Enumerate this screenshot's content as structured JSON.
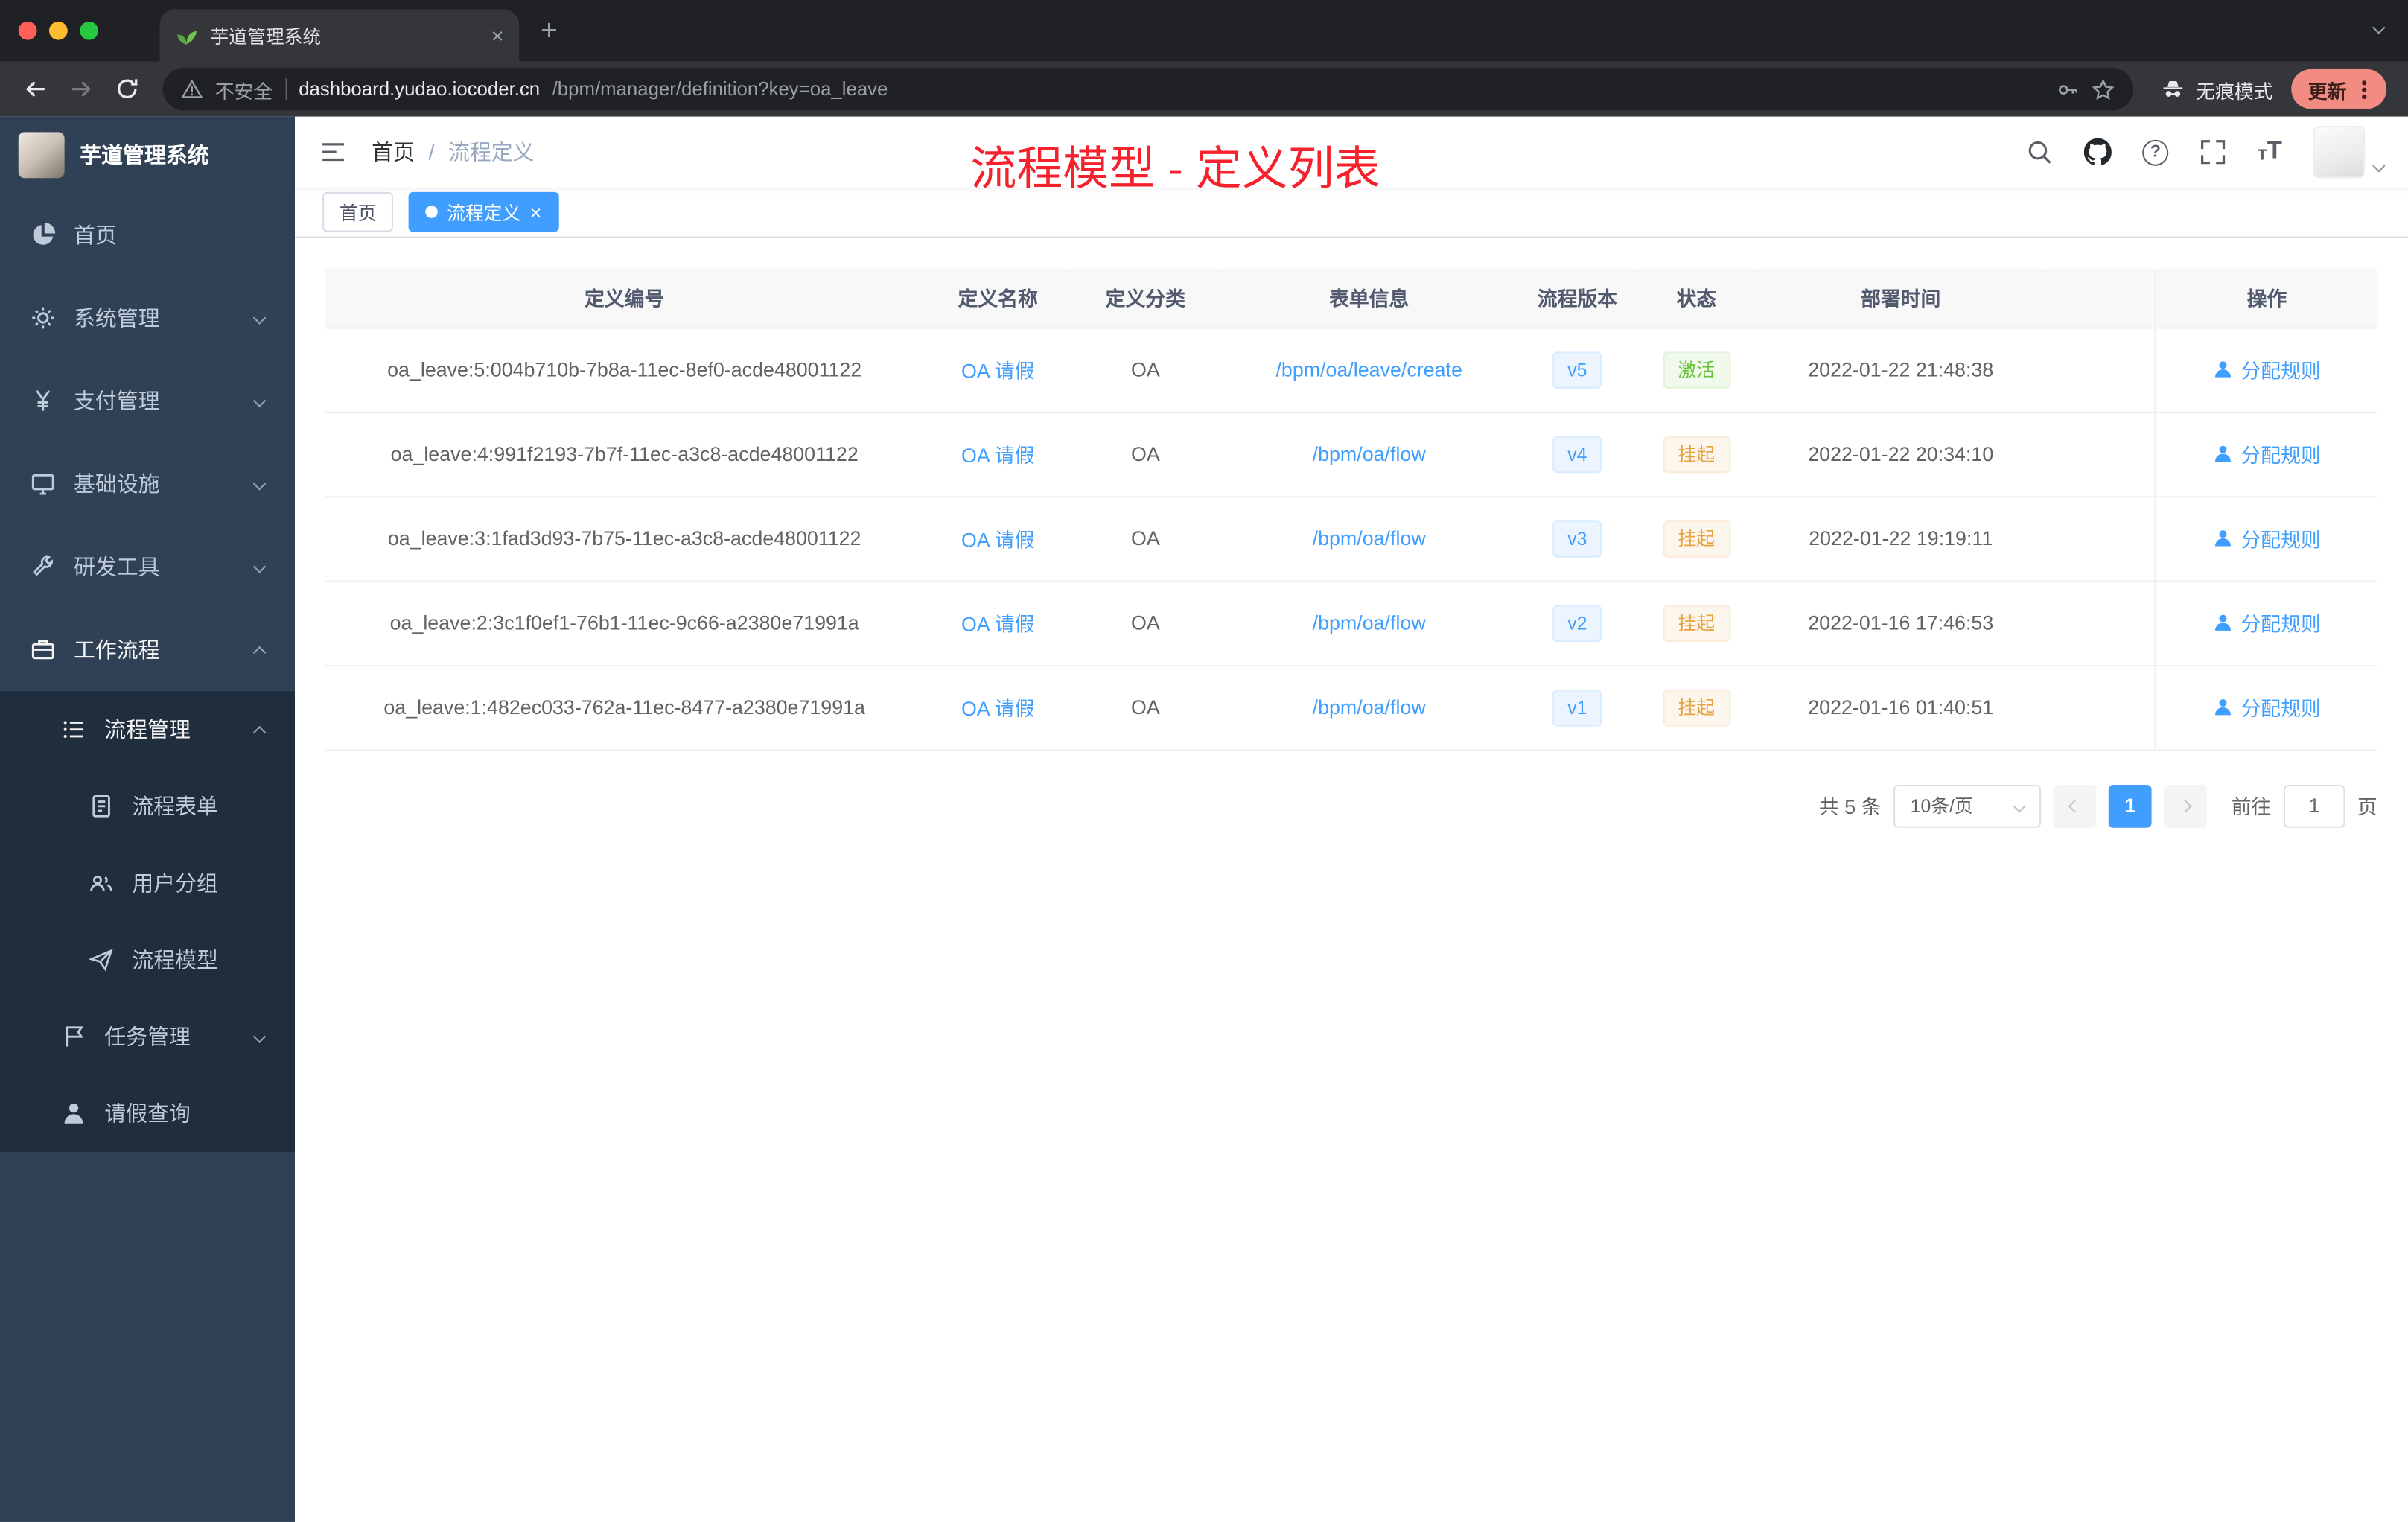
{
  "browser": {
    "tab_title": "芋道管理系统",
    "security_label": "不安全",
    "url_host": "dashboard.yudao.iocoder.cn",
    "url_path": "/bpm/manager/definition?key=oa_leave",
    "incognito_label": "无痕模式",
    "update_label": "更新",
    "icons": [
      "back-icon",
      "forward-icon",
      "reload-icon",
      "warning-icon",
      "key-icon",
      "star-icon",
      "incognito-icon",
      "kebab-menu-icon",
      "new-tab-icon",
      "tab-close-icon",
      "tab-search-icon",
      "site-favicon"
    ]
  },
  "sidebar": {
    "logo_title": "芋道管理系统",
    "items": [
      {
        "label": "首页",
        "icon": "dashboard-icon",
        "level": 1
      },
      {
        "label": "系统管理",
        "icon": "gear-icon",
        "level": 1,
        "state": "collapsed"
      },
      {
        "label": "支付管理",
        "icon": "yen-icon",
        "level": 1,
        "state": "collapsed"
      },
      {
        "label": "基础设施",
        "icon": "monitor-icon",
        "level": 1,
        "state": "collapsed"
      },
      {
        "label": "研发工具",
        "icon": "tool-icon",
        "level": 1,
        "state": "collapsed"
      },
      {
        "label": "工作流程",
        "icon": "briefcase-icon",
        "level": 1,
        "state": "expanded"
      },
      {
        "label": "流程管理",
        "icon": "list-icon",
        "level": 2,
        "state": "expanded"
      },
      {
        "label": "流程表单",
        "icon": "form-icon",
        "level": 3
      },
      {
        "label": "用户分组",
        "icon": "user-group-icon",
        "level": 3
      },
      {
        "label": "流程模型",
        "icon": "paper-plane-icon",
        "level": 3
      },
      {
        "label": "任务管理",
        "icon": "task-icon",
        "level": 2,
        "state": "collapsed"
      },
      {
        "label": "请假查询",
        "icon": "person-icon",
        "level": 2
      }
    ]
  },
  "header": {
    "breadcrumb_home": "首页",
    "breadcrumb_current": "流程定义",
    "annotation": "流程模型 - 定义列表",
    "icons": [
      "hamburger-icon",
      "search-icon",
      "github-icon",
      "help-icon",
      "fullscreen-icon",
      "font-size-icon",
      "avatar",
      "chevron-down-icon"
    ]
  },
  "tags": [
    {
      "label": "首页",
      "active": false
    },
    {
      "label": "流程定义",
      "active": true
    }
  ],
  "table": {
    "columns": [
      "定义编号",
      "定义名称",
      "定义分类",
      "表单信息",
      "流程版本",
      "状态",
      "部署时间",
      "操作"
    ],
    "rows": [
      {
        "id": "oa_leave:5:004b710b-7b8a-11ec-8ef0-acde48001122",
        "name": "OA 请假",
        "category": "OA",
        "form": "/bpm/oa/leave/create",
        "version": "v5",
        "status": "激活",
        "status_type": "success",
        "deploy_time": "2022-01-22 21:48:38",
        "action": "分配规则"
      },
      {
        "id": "oa_leave:4:991f2193-7b7f-11ec-a3c8-acde48001122",
        "name": "OA 请假",
        "category": "OA",
        "form": "/bpm/oa/flow",
        "version": "v4",
        "status": "挂起",
        "status_type": "warning",
        "deploy_time": "2022-01-22 20:34:10",
        "action": "分配规则"
      },
      {
        "id": "oa_leave:3:1fad3d93-7b75-11ec-a3c8-acde48001122",
        "name": "OA 请假",
        "category": "OA",
        "form": "/bpm/oa/flow",
        "version": "v3",
        "status": "挂起",
        "status_type": "warning",
        "deploy_time": "2022-01-22 19:19:11",
        "action": "分配规则"
      },
      {
        "id": "oa_leave:2:3c1f0ef1-76b1-11ec-9c66-a2380e71991a",
        "name": "OA 请假",
        "category": "OA",
        "form": "/bpm/oa/flow",
        "version": "v2",
        "status": "挂起",
        "status_type": "warning",
        "deploy_time": "2022-01-16 17:46:53",
        "action": "分配规则"
      },
      {
        "id": "oa_leave:1:482ec033-762a-11ec-8477-a2380e71991a",
        "name": "OA 请假",
        "category": "OA",
        "form": "/bpm/oa/flow",
        "version": "v1",
        "status": "挂起",
        "status_type": "warning",
        "deploy_time": "2022-01-16 01:40:51",
        "action": "分配规则"
      }
    ]
  },
  "pagination": {
    "total": "共 5 条",
    "page_size": "10条/页",
    "current_page": "1",
    "goto_label": "前往",
    "goto_value": "1",
    "page_unit": "页"
  },
  "colors": {
    "accent": "#409eff",
    "sidebar_bg": "#304156",
    "submenu_bg": "#1f2d3d",
    "annotation_red": "#f5222d",
    "status_success": "#67c23a",
    "status_warning": "#e6a23c",
    "update_pill": "#f28b82"
  }
}
